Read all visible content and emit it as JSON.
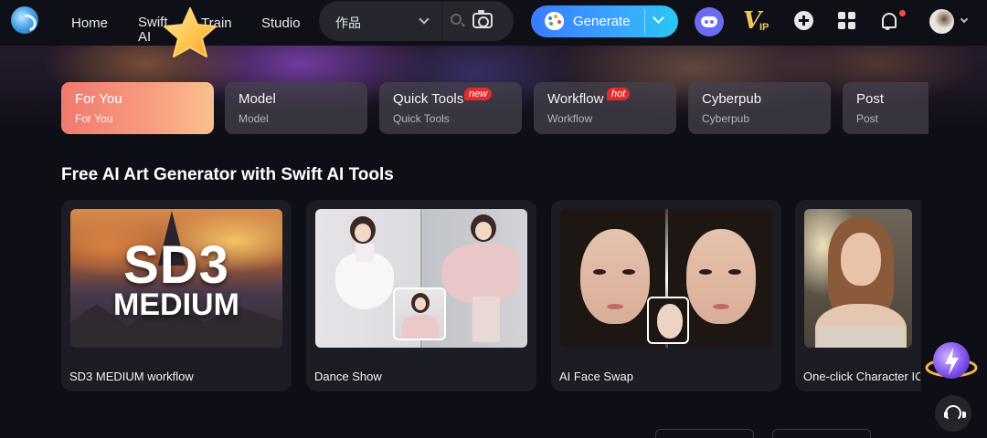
{
  "nav": {
    "links": [
      "Home",
      "Swift\nAI",
      "Train",
      "Studio"
    ],
    "search": {
      "selected_option": "作品"
    },
    "generate_label": "Generate"
  },
  "icons": {
    "logo": "logo-icon",
    "search": "search-icon",
    "camera": "camera-icon",
    "palette": "palette-icon",
    "discord": "discord-icon",
    "vip": "vip-icon",
    "add": "plus-icon",
    "apps": "grid-icon",
    "notifications": "bell-icon",
    "assistant": "assistant-icon",
    "support": "headset-icon"
  },
  "vip_text": {
    "v": "V",
    "ip": "IP"
  },
  "categories": [
    {
      "title": "For You",
      "subtitle": "For You",
      "badge": ""
    },
    {
      "title": "Model",
      "subtitle": "Model",
      "badge": ""
    },
    {
      "title": "Quick Tools",
      "subtitle": "Quick Tools",
      "badge": "new"
    },
    {
      "title": "Workflow",
      "subtitle": "Workflow",
      "badge": "hot"
    },
    {
      "title": "Cyberpub",
      "subtitle": "Cyberpub",
      "badge": ""
    },
    {
      "title": "Post",
      "subtitle": "Post",
      "badge": ""
    }
  ],
  "section": {
    "title": "Free AI Art Generator with Swift AI Tools"
  },
  "cards": [
    {
      "label": "SD3 MEDIUM workflow",
      "thumb_text_big": "SD3",
      "thumb_text_small": "MEDIUM"
    },
    {
      "label": "Dance Show"
    },
    {
      "label": "AI Face Swap"
    },
    {
      "label": "One-click Character IC"
    }
  ],
  "colors": {
    "accent": "#3a8cff",
    "active_tab_start": "#f07a6e",
    "active_tab_end": "#fbc08f",
    "badge": "#e32b2b",
    "notification_dot": "#f04b4b",
    "background": "#0e0e16"
  }
}
